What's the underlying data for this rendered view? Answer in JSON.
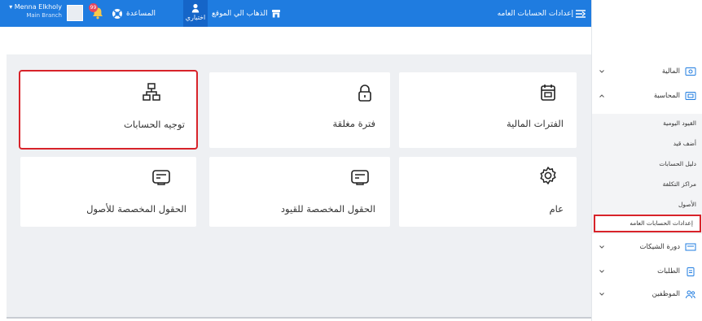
{
  "topbar": {
    "user_name": "Menna Elkholy",
    "user_branch": "Main Branch",
    "notification_count": "99",
    "help_label": "المساعدة",
    "shortcuts_label": "اختياري",
    "goto_site_label": "الذهاب الي الموقع",
    "page_title": "إعدادات الحسابات العامه",
    "accent_color": "#1f7ce0"
  },
  "cards": [
    {
      "label": "الفترات المالية",
      "icon": "calendar-icon"
    },
    {
      "label": "فترة مغلقة",
      "icon": "lock-icon"
    },
    {
      "label": "توجيه الحسابات",
      "icon": "network-icon"
    },
    {
      "label": "عام",
      "icon": "gear-icon"
    },
    {
      "label": "الحقول المخصصة للقيود",
      "icon": "custom-field-icon"
    },
    {
      "label": "الحقول المخصصة للأصول",
      "icon": "custom-field-icon"
    }
  ],
  "sidebar": {
    "groups": [
      {
        "label": "المالية",
        "icon": "wallet-icon"
      },
      {
        "label": "المحاسبة",
        "icon": "accounting-icon"
      },
      {
        "label": "دورة الشيكات",
        "icon": "check-icon"
      },
      {
        "label": "الطلبات",
        "icon": "clipboard-icon"
      },
      {
        "label": "الموظفين",
        "icon": "people-icon"
      }
    ],
    "submenu": [
      "القيود اليومية",
      "أضف قيد",
      "دليل الحسابات",
      "مراكز التكلفة",
      "الأصول",
      "إعدادات الحسابات العامه"
    ]
  }
}
